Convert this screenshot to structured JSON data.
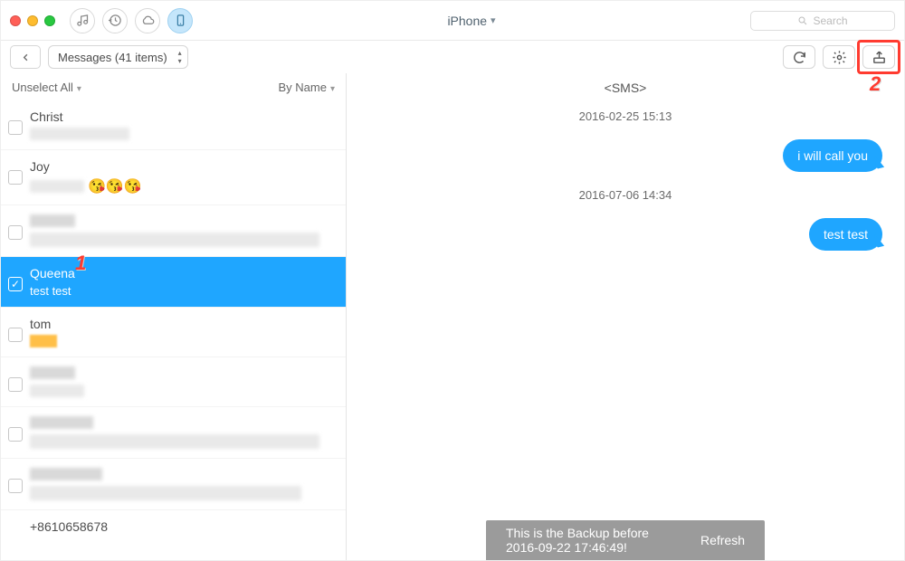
{
  "header": {
    "device_label": "iPhone",
    "search_placeholder": "Search"
  },
  "subheader": {
    "crumb_label": "Messages (41 items)"
  },
  "list": {
    "unselect_label": "Unselect All",
    "sort_label": "By Name",
    "threads": [
      {
        "name": "Christ",
        "preview": "",
        "selected": false,
        "blurred_preview": true,
        "emoji": false
      },
      {
        "name": "Joy",
        "preview": "😘😘😘",
        "selected": false,
        "blurred_preview": true,
        "emoji": true
      },
      {
        "name": "",
        "preview": "",
        "selected": false,
        "blurred_preview": true,
        "blurred_name": true
      },
      {
        "name": "Queena",
        "preview": "test test",
        "selected": true
      },
      {
        "name": "tom",
        "preview": "",
        "selected": false,
        "yellowbox": true
      },
      {
        "name": "",
        "preview": "",
        "selected": false,
        "blurred_preview": true,
        "blurred_name": true
      },
      {
        "name": "",
        "preview": "",
        "selected": false,
        "blurred_preview": true,
        "blurred_name": true,
        "long": true
      },
      {
        "name": "",
        "preview": "",
        "selected": false,
        "blurred_preview": true,
        "blurred_name": true,
        "long": true
      },
      {
        "name": "+8610658678",
        "preview": "",
        "selected": false
      }
    ]
  },
  "detail": {
    "title": "<SMS>",
    "messages": [
      {
        "type": "timestamp",
        "text": "2016-02-25 15:13"
      },
      {
        "type": "out",
        "text": "i will call you"
      },
      {
        "type": "timestamp",
        "text": "2016-07-06 14:34"
      },
      {
        "type": "out",
        "text": "test test"
      }
    ]
  },
  "footer": {
    "toast": "This is the Backup before 2016-09-22 17:46:49!",
    "refresh": "Refresh"
  },
  "callouts": {
    "one": "1",
    "two": "2"
  },
  "icons": {
    "music": "music-icon",
    "history": "history-icon",
    "cloud": "cloud-icon",
    "device": "device-icon",
    "back": "chevron-left-icon",
    "refresh": "refresh-icon",
    "settings": "gear-icon",
    "export": "export-icon",
    "search": "search-icon"
  }
}
